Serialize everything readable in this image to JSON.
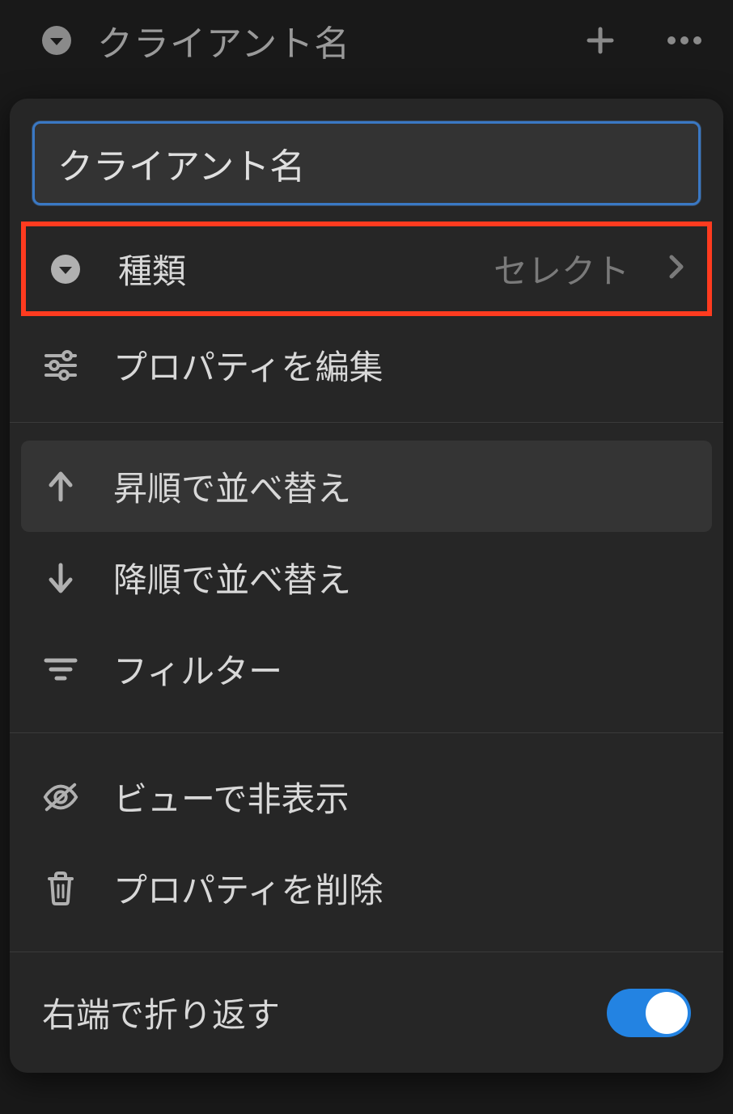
{
  "header": {
    "title": "クライアント名"
  },
  "input": {
    "value": "クライアント名"
  },
  "type_row": {
    "label": "種類",
    "value": "セレクト"
  },
  "edit_property": "プロパティを編集",
  "sort_asc": "昇順で並べ替え",
  "sort_desc": "降順で並べ替え",
  "filter": "フィルター",
  "hide_in_view": "ビューで非表示",
  "delete_property": "プロパティを削除",
  "wrap": {
    "label": "右端で折り返す",
    "enabled": true
  }
}
